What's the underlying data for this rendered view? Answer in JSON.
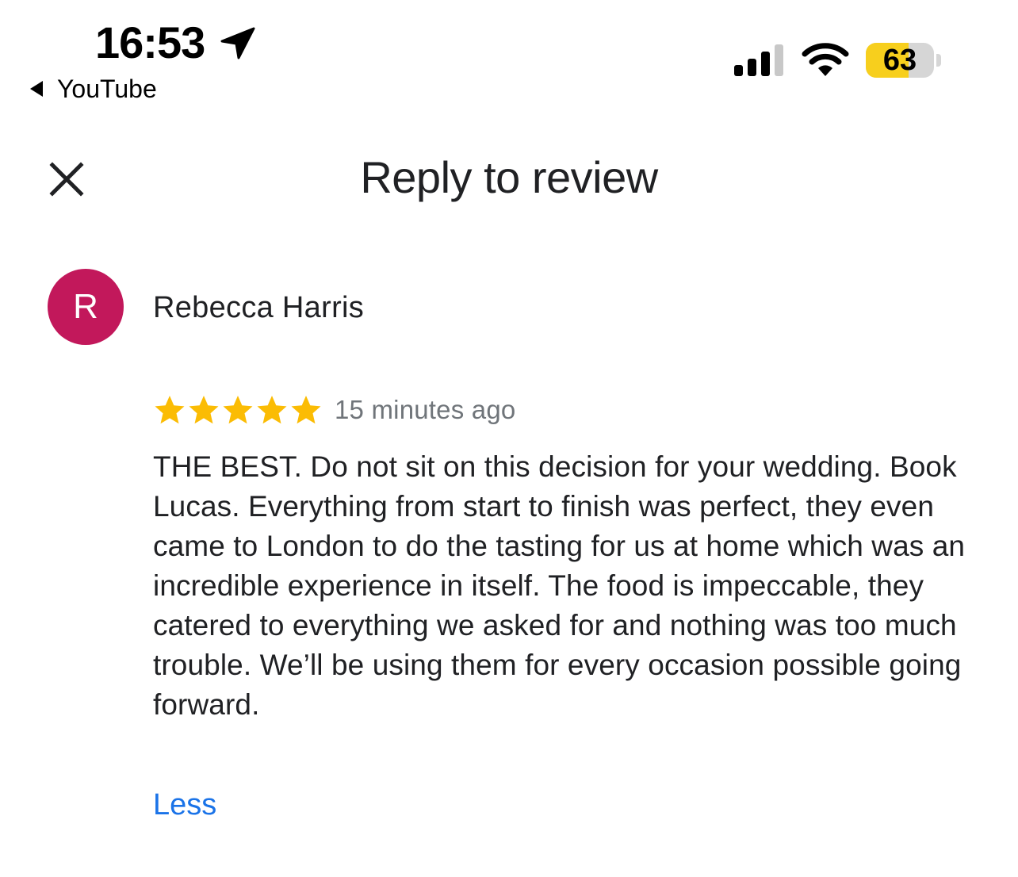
{
  "status_bar": {
    "time": "16:53",
    "back_app": "YouTube",
    "battery_level": "63",
    "battery_fraction": 0.63,
    "battery_color": "#f7cf1d",
    "signal_bars_active": 3,
    "icons": [
      "location-arrow-icon",
      "signal-icon",
      "wifi-icon",
      "battery-icon"
    ]
  },
  "header": {
    "title": "Reply to review",
    "close_icon": "close-icon"
  },
  "review": {
    "avatar_letter": "R",
    "avatar_color": "#c2185b",
    "reviewer_name": "Rebecca Harris",
    "rating": 5,
    "max_rating": 5,
    "star_color": "#fbbc04",
    "time_ago": "15 minutes ago",
    "text": "THE BEST. Do not sit on this decision for your wedding. Book Lucas. Everything from start to finish was perfect, they even came to London to do the tasting for us at home which was an incredible experience in itself. The food is impeccable, they catered to everything we asked for and nothing was too much trouble. We’ll be using them for every occasion possible going forward.",
    "less_label": "Less",
    "link_color": "#1a73e8"
  }
}
